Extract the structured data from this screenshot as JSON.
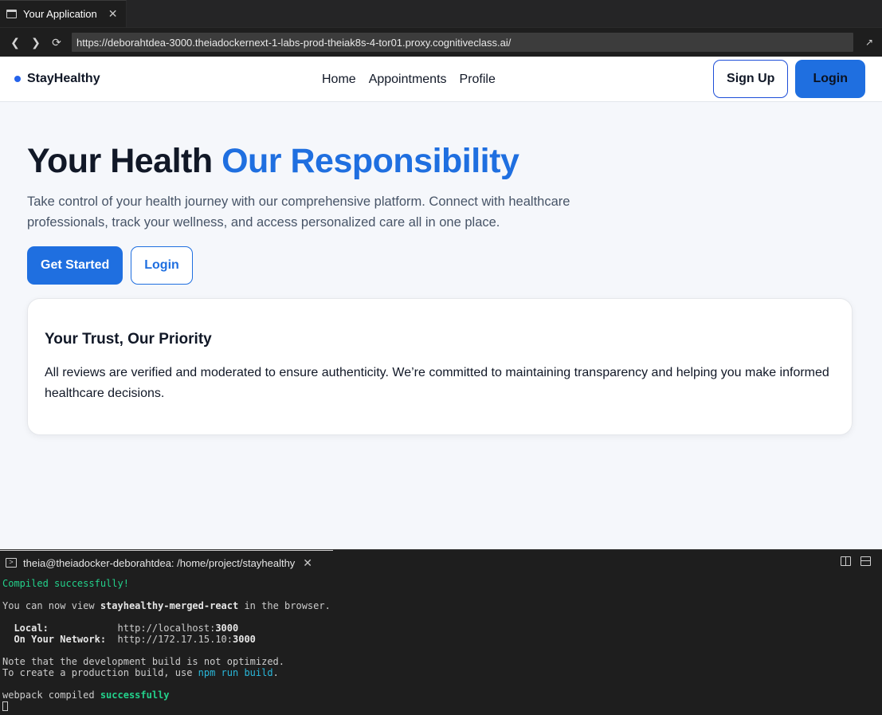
{
  "window": {
    "tab_title": "Your Application",
    "url": "https://deborahtdea-3000.theiadockernext-1-labs-prod-theiak8s-4-tor01.proxy.cognitiveclass.ai/"
  },
  "nav": {
    "brand": "StayHealthy",
    "links": [
      "Home",
      "Appointments",
      "Profile"
    ],
    "signup_label": "Sign Up",
    "login_label": "Login"
  },
  "hero": {
    "title_part1": "Your Health ",
    "title_accent": "Our Responsibility",
    "description": "Take control of your health journey with our comprehensive platform. Connect with healthcare professionals, track your wellness, and access personalized care all in one place.",
    "get_started_label": "Get Started",
    "login_label": "Login"
  },
  "trust_card": {
    "title": "Your Trust, Our Priority",
    "body": "All reviews are verified and moderated to ensure authenticity. We’re committed to maintaining transparency and helping you make informed healthcare decisions."
  },
  "terminal": {
    "tab_title": "theia@theiadocker-deborahtdea: /home/project/stayhealthy",
    "compiled": "Compiled successfully!",
    "view_prefix": "You can now view ",
    "app_name": "stayhealthy-merged-react",
    "view_suffix": " in the browser.",
    "local_label": "  Local:",
    "local_pad": "            ",
    "local_url_prefix": "http://localhost:",
    "local_port": "3000",
    "network_label": "  On Your Network:",
    "network_pad": "  ",
    "network_url_prefix": "http://172.17.15.10:",
    "network_port": "3000",
    "note_line": "Note that the development build is not optimized.",
    "prod_prefix": "To create a production build, use ",
    "prod_cmd": "npm run build",
    "prod_suffix": ".",
    "webpack_prefix": "webpack compiled ",
    "webpack_status": "successfully"
  },
  "colors": {
    "accent": "#1f6fe0",
    "page_bg": "#f5f7fb",
    "terminal_green": "#23d18b",
    "terminal_blue": "#29b8db"
  }
}
